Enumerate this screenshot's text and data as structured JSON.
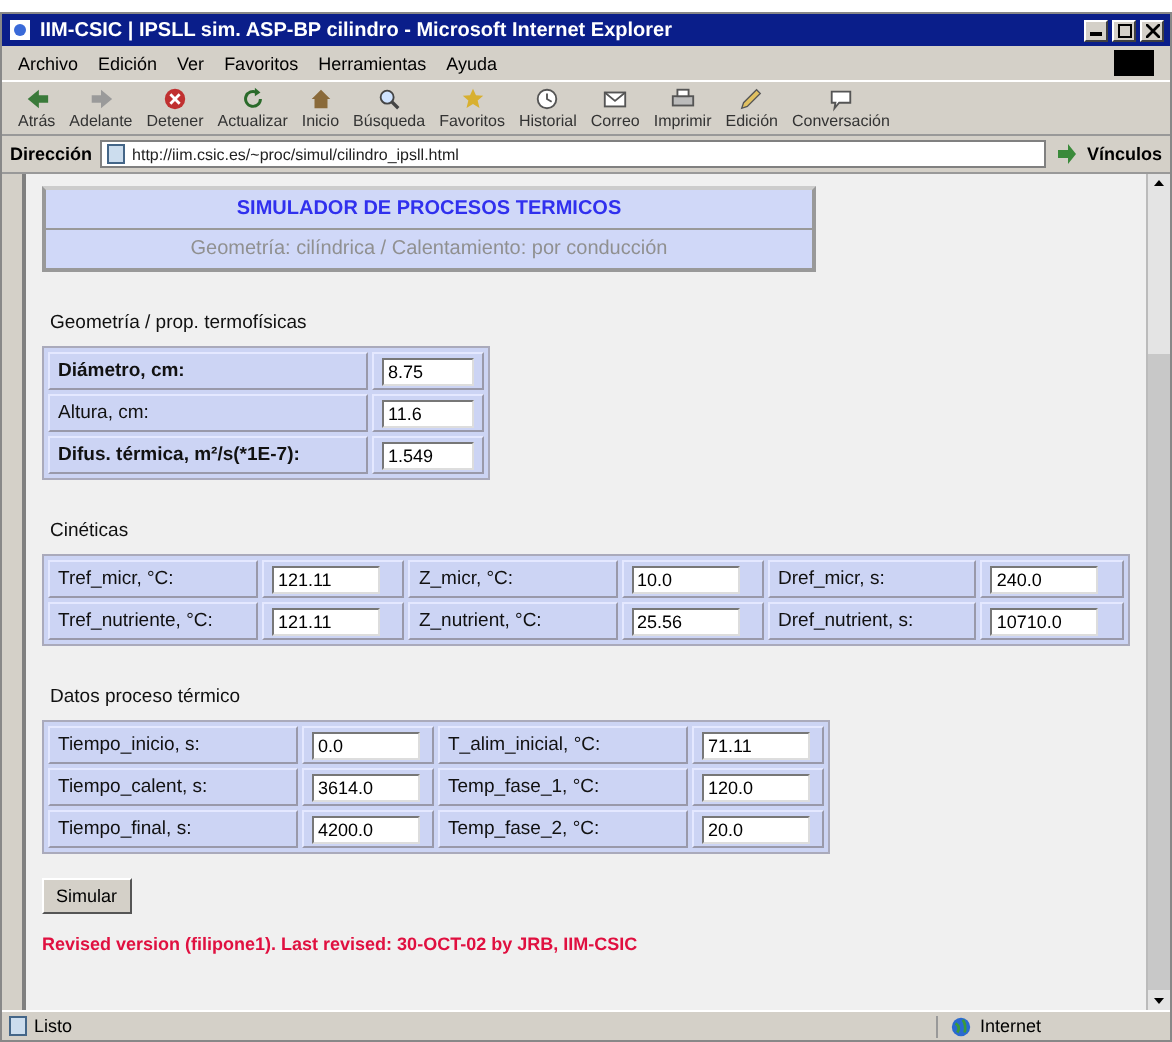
{
  "window": {
    "title": "IIM-CSIC | IPSLL sim. ASP-BP cilindro - Microsoft Internet Explorer"
  },
  "menu": [
    "Archivo",
    "Edición",
    "Ver",
    "Favoritos",
    "Herramientas",
    "Ayuda"
  ],
  "toolbar": [
    {
      "kind": "back",
      "label": "Atrás"
    },
    {
      "kind": "forward",
      "label": "Adelante"
    },
    {
      "kind": "stop",
      "label": "Detener"
    },
    {
      "kind": "refresh",
      "label": "Actualizar"
    },
    {
      "kind": "home",
      "label": "Inicio"
    },
    {
      "kind": "search",
      "label": "Búsqueda"
    },
    {
      "kind": "favorites",
      "label": "Favoritos"
    },
    {
      "kind": "history",
      "label": "Historial"
    },
    {
      "kind": "mail",
      "label": "Correo"
    },
    {
      "kind": "print",
      "label": "Imprimir"
    },
    {
      "kind": "edit",
      "label": "Edición"
    },
    {
      "kind": "discuss",
      "label": "Conversación"
    }
  ],
  "address": {
    "label": "Dirección",
    "value": "http://iim.csic.es/~proc/simul/cilindro_ipsll.html",
    "links": "Vínculos"
  },
  "header": {
    "title": "SIMULADOR DE PROCESOS TERMICOS",
    "subtitle": "Geometría: cilíndrica / Calentamiento: por conducción"
  },
  "geometry": {
    "heading": "Geometría / prop. termofísicas",
    "fields": [
      {
        "label": "Diámetro, cm:",
        "value": "8.75"
      },
      {
        "label": "Altura, cm:",
        "value": "11.6"
      },
      {
        "label": "Difus. térmica, m²/s(*1E-7):",
        "value": "1.549"
      }
    ]
  },
  "kinetics": {
    "heading": "Cinéticas",
    "rows": [
      [
        {
          "label": "Tref_micr, °C:",
          "value": "121.11"
        },
        {
          "label": "Z_micr, °C:",
          "value": "10.0"
        },
        {
          "label": "Dref_micr, s:",
          "value": "240.0"
        }
      ],
      [
        {
          "label": "Tref_nutriente, °C:",
          "value": "121.11"
        },
        {
          "label": "Z_nutrient, °C:",
          "value": "25.56"
        },
        {
          "label": "Dref_nutrient, s:",
          "value": "10710.0"
        }
      ]
    ]
  },
  "process": {
    "heading": "Datos proceso térmico",
    "rows": [
      [
        {
          "label": "Tiempo_inicio, s:",
          "value": "0.0"
        },
        {
          "label": "T_alim_inicial, °C:",
          "value": "71.11"
        }
      ],
      [
        {
          "label": "Tiempo_calent, s:",
          "value": "3614.0"
        },
        {
          "label": "Temp_fase_1, °C:",
          "value": "120.0"
        }
      ],
      [
        {
          "label": "Tiempo_final, s:",
          "value": "4200.0"
        },
        {
          "label": "Temp_fase_2, °C:",
          "value": "20.0"
        }
      ]
    ]
  },
  "button": "Simular",
  "note": "Revised version (filipone1). Last revised: 30-OCT-02 by JRB, IIM-CSIC",
  "status_bar": {
    "text": "Listo",
    "zone": "Internet"
  }
}
